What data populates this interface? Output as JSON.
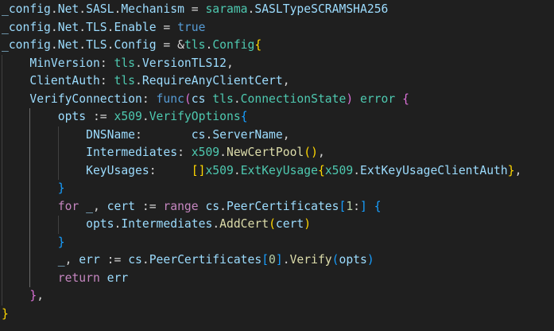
{
  "colors": {
    "background": "#1f1f1f",
    "plain": "#d4d4d4",
    "variable": "#9cdcfe",
    "package": "#4ec9b0",
    "function": "#dcdcaa",
    "keyword": "#569cd6",
    "control": "#c586c0",
    "number": "#b5cea8",
    "bracket_gold": "#ffd700",
    "bracket_purple": "#da70d6",
    "bracket_blue": "#179fff",
    "indent_guide": "#404040"
  },
  "code_lines": [
    [
      {
        "t": "_config",
        "c": "variable"
      },
      {
        "t": ".",
        "c": "plain"
      },
      {
        "t": "Net",
        "c": "variable"
      },
      {
        "t": ".",
        "c": "plain"
      },
      {
        "t": "SASL",
        "c": "variable"
      },
      {
        "t": ".",
        "c": "plain"
      },
      {
        "t": "Mechanism",
        "c": "variable"
      },
      {
        "t": " = ",
        "c": "plain"
      },
      {
        "t": "sarama",
        "c": "package"
      },
      {
        "t": ".",
        "c": "plain"
      },
      {
        "t": "SASLTypeSCRAMSHA256",
        "c": "variable"
      }
    ],
    [
      {
        "t": "_config",
        "c": "variable"
      },
      {
        "t": ".",
        "c": "plain"
      },
      {
        "t": "Net",
        "c": "variable"
      },
      {
        "t": ".",
        "c": "plain"
      },
      {
        "t": "TLS",
        "c": "variable"
      },
      {
        "t": ".",
        "c": "plain"
      },
      {
        "t": "Enable",
        "c": "variable"
      },
      {
        "t": " = ",
        "c": "plain"
      },
      {
        "t": "true",
        "c": "keyword"
      }
    ],
    [
      {
        "t": "_config",
        "c": "variable"
      },
      {
        "t": ".",
        "c": "plain"
      },
      {
        "t": "Net",
        "c": "variable"
      },
      {
        "t": ".",
        "c": "plain"
      },
      {
        "t": "TLS",
        "c": "variable"
      },
      {
        "t": ".",
        "c": "plain"
      },
      {
        "t": "Config",
        "c": "variable"
      },
      {
        "t": " = &",
        "c": "plain"
      },
      {
        "t": "tls",
        "c": "package"
      },
      {
        "t": ".",
        "c": "plain"
      },
      {
        "t": "Config",
        "c": "package"
      },
      {
        "t": "{",
        "c": "bracket_gold"
      }
    ],
    [
      {
        "t": "    ",
        "c": "plain"
      },
      {
        "t": "MinVersion",
        "c": "variable"
      },
      {
        "t": ": ",
        "c": "plain"
      },
      {
        "t": "tls",
        "c": "package"
      },
      {
        "t": ".",
        "c": "plain"
      },
      {
        "t": "VersionTLS12",
        "c": "variable"
      },
      {
        "t": ",",
        "c": "plain"
      }
    ],
    [
      {
        "t": "    ",
        "c": "plain"
      },
      {
        "t": "ClientAuth",
        "c": "variable"
      },
      {
        "t": ": ",
        "c": "plain"
      },
      {
        "t": "tls",
        "c": "package"
      },
      {
        "t": ".",
        "c": "plain"
      },
      {
        "t": "RequireAnyClientCert",
        "c": "variable"
      },
      {
        "t": ",",
        "c": "plain"
      }
    ],
    [
      {
        "t": "    ",
        "c": "plain"
      },
      {
        "t": "VerifyConnection",
        "c": "variable"
      },
      {
        "t": ": ",
        "c": "plain"
      },
      {
        "t": "func",
        "c": "keyword"
      },
      {
        "t": "(",
        "c": "bracket_purple"
      },
      {
        "t": "cs",
        "c": "variable"
      },
      {
        "t": " ",
        "c": "plain"
      },
      {
        "t": "tls",
        "c": "package"
      },
      {
        "t": ".",
        "c": "plain"
      },
      {
        "t": "ConnectionState",
        "c": "package"
      },
      {
        "t": ")",
        "c": "bracket_purple"
      },
      {
        "t": " ",
        "c": "plain"
      },
      {
        "t": "error",
        "c": "package"
      },
      {
        "t": " ",
        "c": "plain"
      },
      {
        "t": "{",
        "c": "bracket_purple"
      }
    ],
    [
      {
        "t": "        ",
        "c": "plain"
      },
      {
        "t": "opts",
        "c": "variable"
      },
      {
        "t": " := ",
        "c": "plain"
      },
      {
        "t": "x509",
        "c": "package"
      },
      {
        "t": ".",
        "c": "plain"
      },
      {
        "t": "VerifyOptions",
        "c": "package"
      },
      {
        "t": "{",
        "c": "bracket_blue"
      }
    ],
    [
      {
        "t": "            ",
        "c": "plain"
      },
      {
        "t": "DNSName",
        "c": "variable"
      },
      {
        "t": ":       ",
        "c": "plain"
      },
      {
        "t": "cs",
        "c": "variable"
      },
      {
        "t": ".",
        "c": "plain"
      },
      {
        "t": "ServerName",
        "c": "variable"
      },
      {
        "t": ",",
        "c": "plain"
      }
    ],
    [
      {
        "t": "            ",
        "c": "plain"
      },
      {
        "t": "Intermediates",
        "c": "variable"
      },
      {
        "t": ": ",
        "c": "plain"
      },
      {
        "t": "x509",
        "c": "package"
      },
      {
        "t": ".",
        "c": "plain"
      },
      {
        "t": "NewCertPool",
        "c": "function"
      },
      {
        "t": "()",
        "c": "bracket_gold"
      },
      {
        "t": ",",
        "c": "plain"
      }
    ],
    [
      {
        "t": "            ",
        "c": "plain"
      },
      {
        "t": "KeyUsages",
        "c": "variable"
      },
      {
        "t": ":     ",
        "c": "plain"
      },
      {
        "t": "[]",
        "c": "bracket_gold"
      },
      {
        "t": "x509",
        "c": "package"
      },
      {
        "t": ".",
        "c": "plain"
      },
      {
        "t": "ExtKeyUsage",
        "c": "package"
      },
      {
        "t": "{",
        "c": "bracket_gold"
      },
      {
        "t": "x509",
        "c": "package"
      },
      {
        "t": ".",
        "c": "plain"
      },
      {
        "t": "ExtKeyUsageClientAuth",
        "c": "variable"
      },
      {
        "t": "}",
        "c": "bracket_gold"
      },
      {
        "t": ",",
        "c": "plain"
      }
    ],
    [
      {
        "t": "        ",
        "c": "plain"
      },
      {
        "t": "}",
        "c": "bracket_blue"
      }
    ],
    [
      {
        "t": "        ",
        "c": "plain"
      },
      {
        "t": "for",
        "c": "control"
      },
      {
        "t": " ",
        "c": "plain"
      },
      {
        "t": "_",
        "c": "variable"
      },
      {
        "t": ", ",
        "c": "plain"
      },
      {
        "t": "cert",
        "c": "variable"
      },
      {
        "t": " := ",
        "c": "plain"
      },
      {
        "t": "range",
        "c": "control"
      },
      {
        "t": " ",
        "c": "plain"
      },
      {
        "t": "cs",
        "c": "variable"
      },
      {
        "t": ".",
        "c": "plain"
      },
      {
        "t": "PeerCertificates",
        "c": "variable"
      },
      {
        "t": "[",
        "c": "bracket_blue"
      },
      {
        "t": "1",
        "c": "number"
      },
      {
        "t": ":",
        "c": "plain"
      },
      {
        "t": "]",
        "c": "bracket_blue"
      },
      {
        "t": " ",
        "c": "plain"
      },
      {
        "t": "{",
        "c": "bracket_blue"
      }
    ],
    [
      {
        "t": "            ",
        "c": "plain"
      },
      {
        "t": "opts",
        "c": "variable"
      },
      {
        "t": ".",
        "c": "plain"
      },
      {
        "t": "Intermediates",
        "c": "variable"
      },
      {
        "t": ".",
        "c": "plain"
      },
      {
        "t": "AddCert",
        "c": "function"
      },
      {
        "t": "(",
        "c": "bracket_gold"
      },
      {
        "t": "cert",
        "c": "variable"
      },
      {
        "t": ")",
        "c": "bracket_gold"
      }
    ],
    [
      {
        "t": "        ",
        "c": "plain"
      },
      {
        "t": "}",
        "c": "bracket_blue"
      }
    ],
    [
      {
        "t": "        ",
        "c": "plain"
      },
      {
        "t": "_",
        "c": "variable"
      },
      {
        "t": ", ",
        "c": "plain"
      },
      {
        "t": "err",
        "c": "variable"
      },
      {
        "t": " := ",
        "c": "plain"
      },
      {
        "t": "cs",
        "c": "variable"
      },
      {
        "t": ".",
        "c": "plain"
      },
      {
        "t": "PeerCertificates",
        "c": "variable"
      },
      {
        "t": "[",
        "c": "bracket_blue"
      },
      {
        "t": "0",
        "c": "number"
      },
      {
        "t": "]",
        "c": "bracket_blue"
      },
      {
        "t": ".",
        "c": "plain"
      },
      {
        "t": "Verify",
        "c": "function"
      },
      {
        "t": "(",
        "c": "bracket_blue"
      },
      {
        "t": "opts",
        "c": "variable"
      },
      {
        "t": ")",
        "c": "bracket_blue"
      }
    ],
    [
      {
        "t": "        ",
        "c": "plain"
      },
      {
        "t": "return",
        "c": "control"
      },
      {
        "t": " ",
        "c": "plain"
      },
      {
        "t": "err",
        "c": "variable"
      }
    ],
    [
      {
        "t": "    ",
        "c": "plain"
      },
      {
        "t": "}",
        "c": "bracket_purple"
      },
      {
        "t": ",",
        "c": "plain"
      }
    ],
    [
      {
        "t": "}",
        "c": "bracket_gold"
      }
    ]
  ]
}
